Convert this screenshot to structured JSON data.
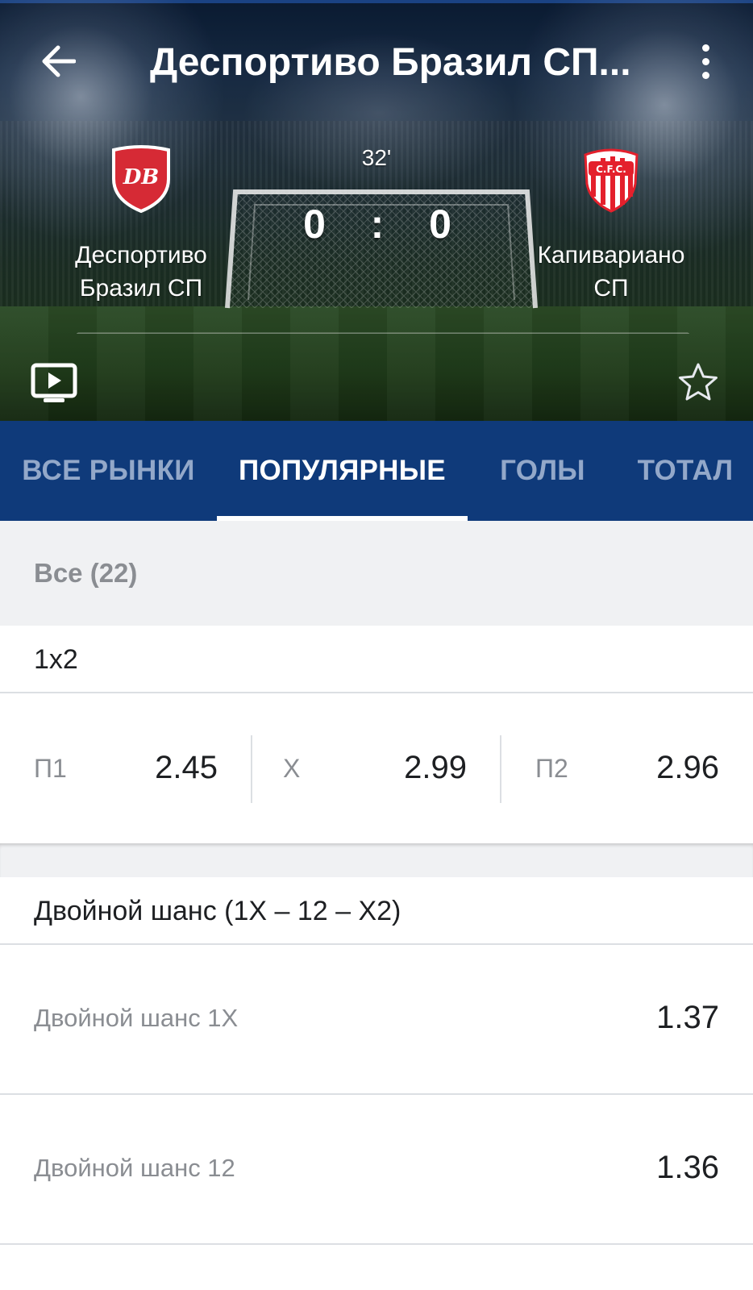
{
  "header": {
    "title": "Деспортиво Бразил СП...",
    "back_icon": "arrow-left-icon",
    "menu_icon": "more-vertical-icon"
  },
  "match": {
    "time": "32'",
    "home": {
      "name_line1": "Деспортиво",
      "name_line2": "Бразил СП",
      "crest_text": "DB",
      "crest_color": "#d62a35"
    },
    "away": {
      "name_line1": "Капивариано",
      "name_line2": "СП",
      "crest_text": "C.F.C.",
      "crest_color": "#e4202c"
    },
    "score_home": "0",
    "score_sep": ":",
    "score_away": "0",
    "tv_icon": "live-tv-icon",
    "favorite_icon": "star-outline-icon"
  },
  "tabs": [
    {
      "label": "ВСЕ РЫНКИ",
      "active": false
    },
    {
      "label": "ПОПУЛЯРНЫЕ",
      "active": true
    },
    {
      "label": "ГОЛЫ",
      "active": false
    },
    {
      "label": "ТОТАЛ",
      "active": false
    }
  ],
  "filter": {
    "label": "Все (22)"
  },
  "markets": [
    {
      "title": "1x2",
      "odds": [
        {
          "label": "П1",
          "value": "2.45"
        },
        {
          "label": "Х",
          "value": "2.99"
        },
        {
          "label": "П2",
          "value": "2.96"
        }
      ]
    },
    {
      "title": "Двойной шанс (1X – 12 – X2)",
      "lines": [
        {
          "label": "Двойной шанс 1X",
          "value": "1.37"
        },
        {
          "label": "Двойной шанс 12",
          "value": "1.36"
        }
      ]
    }
  ],
  "colors": {
    "tab_bar": "#0f3a7a",
    "tab_inactive": "#93a8c9",
    "tab_active": "#ffffff",
    "list_bg": "#f0f1f3",
    "label_grey": "#8a8d92",
    "text_dark": "#1d1f22"
  }
}
